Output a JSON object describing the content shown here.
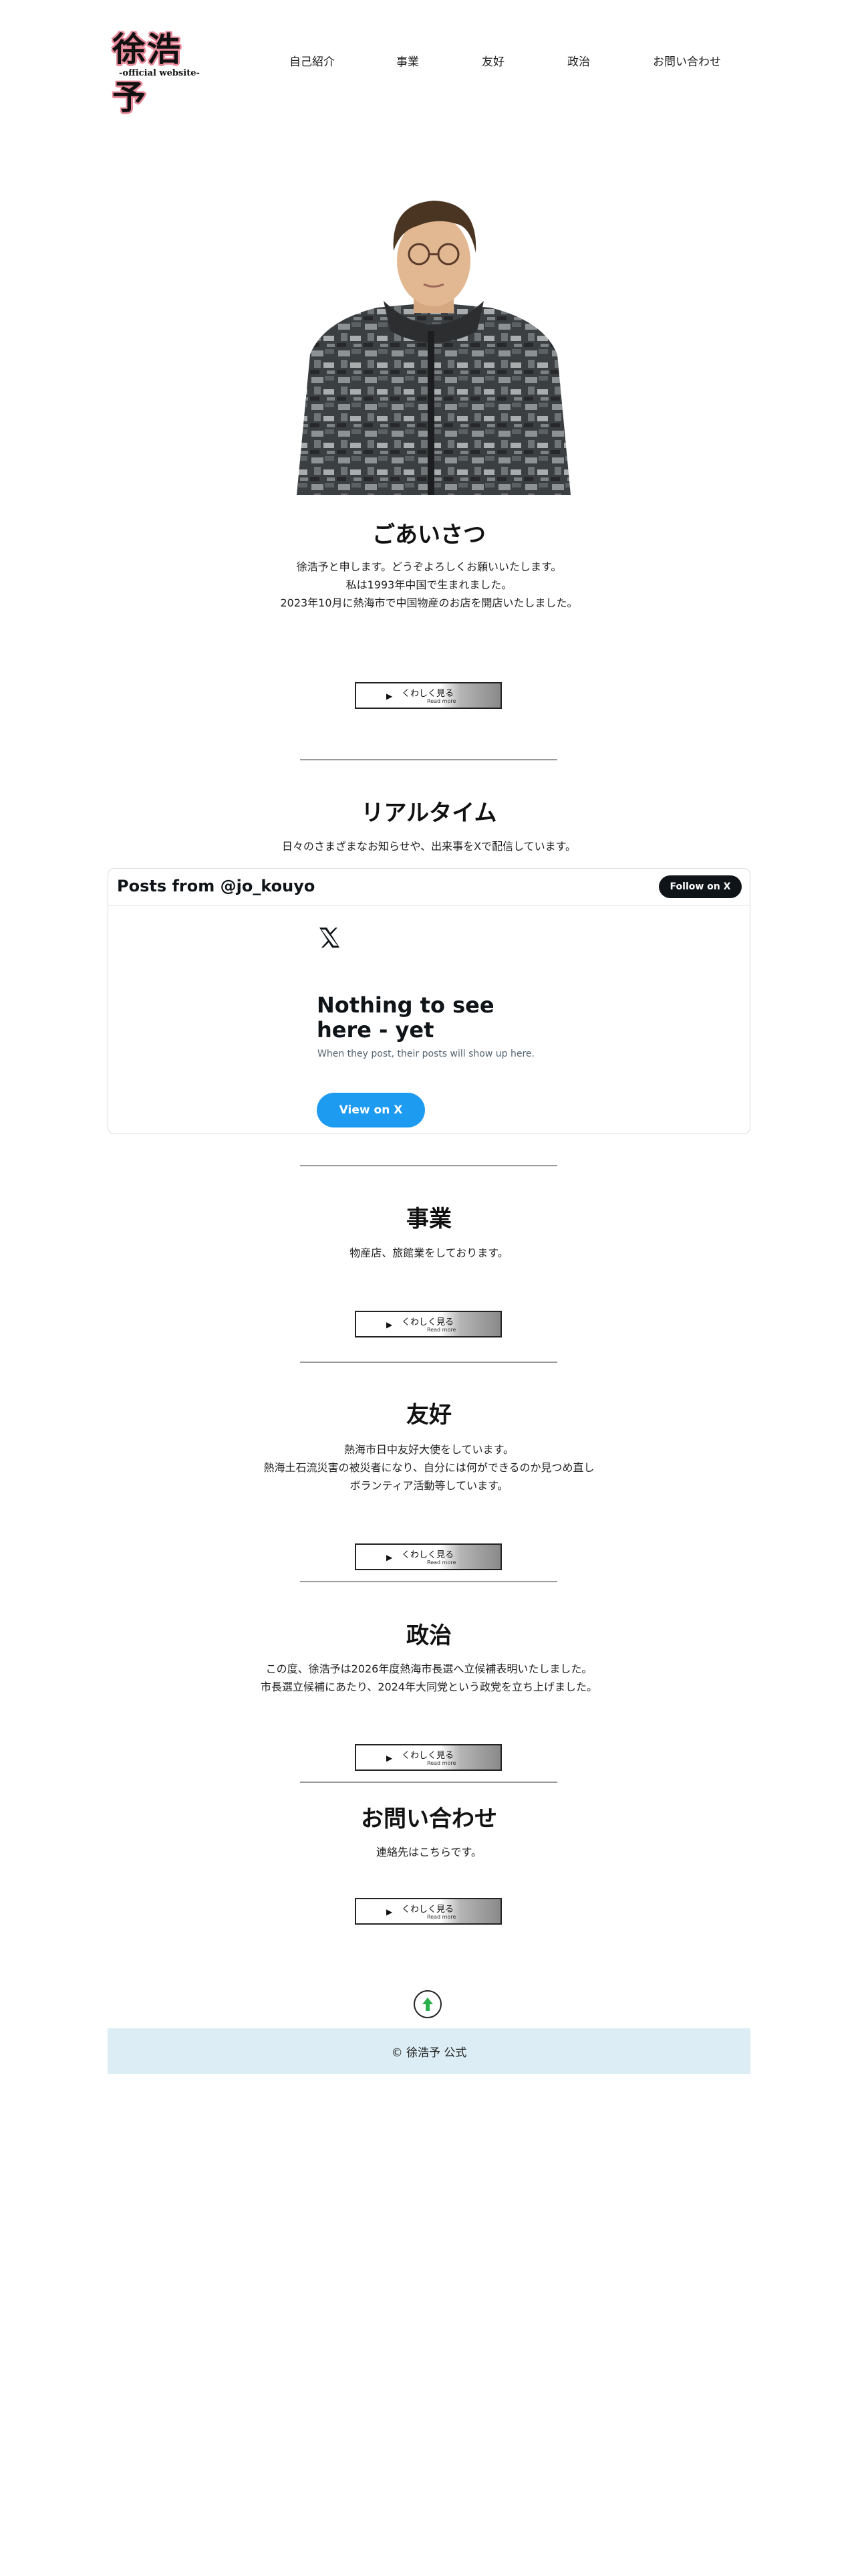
{
  "header": {
    "logo_title": "徐浩予",
    "logo_subtitle": "-official website-",
    "nav": [
      "自己紹介",
      "事業",
      "友好",
      "政治",
      "お問い合わせ"
    ]
  },
  "more_button": {
    "jp": "くわしく見る",
    "en": "Read more"
  },
  "greeting": {
    "title": "ごあいさつ",
    "lines": [
      "徐浩予と申します。どうぞよろしくお願いいたします。",
      "私は1993年中国で生まれました。",
      "2023年10月に熱海市で中国物産のお店を開店いたしました。"
    ]
  },
  "realtime": {
    "title": "リアルタイム",
    "lines": [
      "日々のさまざまなお知らせや、出来事をXで配信しています。"
    ],
    "widget": {
      "title": "Posts from @jo_kouyo",
      "follow": "Follow on X",
      "empty_title": "Nothing to see here - yet",
      "empty_sub": "When they post, their posts will show up here.",
      "view": "View on X"
    }
  },
  "business": {
    "title": "事業",
    "lines": [
      "物産店、旅館業をしております。"
    ]
  },
  "friendship": {
    "title": "友好",
    "lines": [
      "熱海市日中友好大使をしています。",
      "熱海土石流災害の被災者になり、自分には何ができるのか見つめ直し",
      "ボランティア活動等しています。"
    ]
  },
  "politics": {
    "title": "政治",
    "lines": [
      "この度、徐浩予は2026年度熱海市長選へ立候補表明いたしました。",
      "市長選立候補にあたり、2024年大同党という政党を立ち上げました。"
    ]
  },
  "contact": {
    "title": "お問い合わせ",
    "lines": [
      "連絡先はこちらです。"
    ]
  },
  "footer": {
    "text": "© 徐浩予 公式"
  },
  "colors": {
    "accent_blue": "#1d9bf0",
    "footer_bg": "#dcedf5",
    "logo_pink": "#e98a9a",
    "top_arrow": "#2ab04a"
  }
}
